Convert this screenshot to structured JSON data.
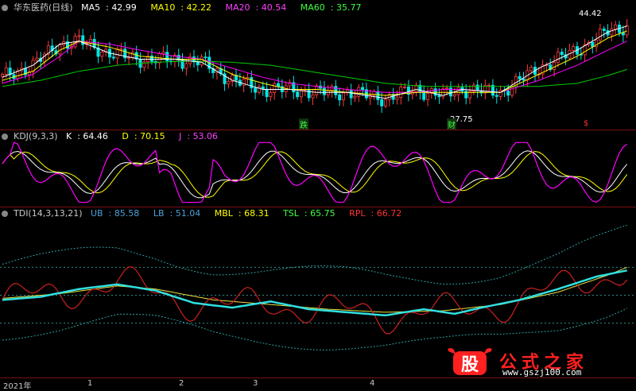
{
  "chart_data": [
    {
      "type": "candlestick",
      "title": "华东医药(日线)",
      "indicators": [
        {
          "name": "MA5",
          "value": "42.99",
          "color": "#ffffff"
        },
        {
          "name": "MA10",
          "value": "42.22",
          "color": "#ffff00"
        },
        {
          "name": "MA20",
          "value": "40.54",
          "color": "#ff00ff"
        },
        {
          "name": "MA60",
          "value": "35.77",
          "color": "#00ff00"
        }
      ],
      "annotations": {
        "high_label": "44.42",
        "low_label": "27.75"
      },
      "badges": [
        "跌",
        "财",
        "$"
      ],
      "ylim": [
        26.5,
        46
      ],
      "ma_anchors": {
        "MA5": [
          [
            0,
            34.5
          ],
          [
            8,
            36.5
          ],
          [
            15,
            40
          ],
          [
            20,
            40.5
          ],
          [
            28,
            38.5
          ],
          [
            36,
            37.5
          ],
          [
            45,
            37.5
          ],
          [
            52,
            37
          ],
          [
            60,
            34
          ],
          [
            68,
            32.5
          ],
          [
            75,
            32.5
          ],
          [
            82,
            32
          ],
          [
            90,
            32
          ],
          [
            100,
            31
          ],
          [
            108,
            32.5
          ],
          [
            115,
            31.5
          ],
          [
            120,
            32.5
          ],
          [
            130,
            32
          ],
          [
            140,
            36
          ],
          [
            150,
            39
          ],
          [
            158,
            42
          ],
          [
            163,
            43
          ]
        ],
        "MA10": [
          [
            0,
            34
          ],
          [
            8,
            35.5
          ],
          [
            15,
            39
          ],
          [
            20,
            40.5
          ],
          [
            28,
            39.5
          ],
          [
            36,
            38
          ],
          [
            45,
            37.5
          ],
          [
            52,
            37.5
          ],
          [
            60,
            35
          ],
          [
            68,
            33.5
          ],
          [
            75,
            32.5
          ],
          [
            82,
            32.5
          ],
          [
            90,
            32
          ],
          [
            100,
            31.5
          ],
          [
            108,
            32
          ],
          [
            115,
            32
          ],
          [
            120,
            32
          ],
          [
            130,
            32
          ],
          [
            140,
            35
          ],
          [
            150,
            38
          ],
          [
            158,
            41
          ],
          [
            163,
            42.2
          ]
        ],
        "MA20": [
          [
            0,
            33.5
          ],
          [
            8,
            35
          ],
          [
            15,
            38
          ],
          [
            20,
            40.5
          ],
          [
            28,
            40
          ],
          [
            36,
            39
          ],
          [
            45,
            38
          ],
          [
            52,
            37.5
          ],
          [
            60,
            36
          ],
          [
            68,
            34.5
          ],
          [
            75,
            33.5
          ],
          [
            82,
            33
          ],
          [
            90,
            32.5
          ],
          [
            100,
            32
          ],
          [
            108,
            32
          ],
          [
            115,
            32.5
          ],
          [
            120,
            32.5
          ],
          [
            130,
            32
          ],
          [
            140,
            34
          ],
          [
            150,
            36.5
          ],
          [
            158,
            39
          ],
          [
            163,
            40.5
          ]
        ],
        "MA60": [
          [
            0,
            33
          ],
          [
            10,
            34
          ],
          [
            20,
            35.5
          ],
          [
            30,
            36.5
          ],
          [
            40,
            37
          ],
          [
            50,
            37.2
          ],
          [
            60,
            37
          ],
          [
            70,
            36.5
          ],
          [
            80,
            35.5
          ],
          [
            90,
            34.5
          ],
          [
            100,
            33.5
          ],
          [
            110,
            33
          ],
          [
            120,
            33
          ],
          [
            130,
            33
          ],
          [
            140,
            33
          ],
          [
            150,
            33.5
          ],
          [
            158,
            34.8
          ],
          [
            163,
            35.8
          ]
        ]
      }
    },
    {
      "type": "line",
      "title": "KDJ(9,3,3)",
      "indicators": [
        {
          "name": "K",
          "value": "64.46",
          "color": "#ffffff"
        },
        {
          "name": "D",
          "value": "70.15",
          "color": "#ffff00"
        },
        {
          "name": "J",
          "value": "53.06",
          "color": "#ff00ff"
        }
      ],
      "ylim": [
        -10,
        110
      ]
    },
    {
      "type": "line",
      "title": "TDI(14,3,13,21)",
      "indicators": [
        {
          "name": "UB",
          "value": "85.58",
          "color": "#4aa0d8"
        },
        {
          "name": "LB",
          "value": "51.04",
          "color": "#4aa0d8"
        },
        {
          "name": "MBL",
          "value": "68.31",
          "color": "#ffff00"
        },
        {
          "name": "TSL",
          "value": "65.75",
          "color": "#00ff00"
        },
        {
          "name": "RPL",
          "value": "66.72",
          "color": "#ff2020"
        }
      ],
      "ylim": [
        0,
        100
      ],
      "reference_levels": [
        32,
        50,
        68
      ]
    }
  ],
  "x_axis": {
    "labels": [
      "2021年",
      "1",
      "2",
      "3",
      "4"
    ]
  },
  "watermark": {
    "brand": "公式之家",
    "url": "www.gszj100.com",
    "emblem": "股"
  }
}
